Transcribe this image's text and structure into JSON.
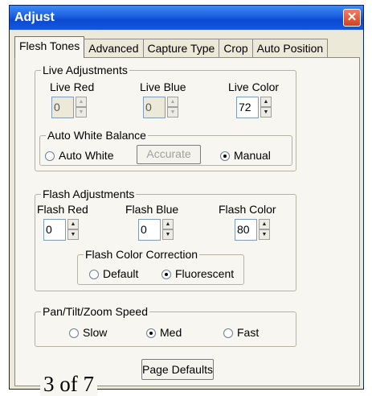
{
  "window": {
    "title": "Adjust",
    "close_glyph": "✕"
  },
  "tabs": [
    "Flesh Tones",
    "Advanced",
    "Capture Type",
    "Crop",
    "Auto Position"
  ],
  "live": {
    "legend": "Live Adjustments",
    "red": {
      "label": "Live Red",
      "value": "0"
    },
    "blue": {
      "label": "Live Blue",
      "value": "0"
    },
    "color": {
      "label": "Live Color",
      "value": "72"
    }
  },
  "awb": {
    "legend": "Auto White Balance",
    "auto_white": "Auto White",
    "accurate": "Accurate",
    "manual": "Manual",
    "selected": "manual"
  },
  "flash": {
    "legend": "Flash Adjustments",
    "red": {
      "label": "Flash Red",
      "value": "0"
    },
    "blue": {
      "label": "Flash Blue",
      "value": "0"
    },
    "color": {
      "label": "Flash Color",
      "value": "80"
    }
  },
  "fcc": {
    "legend": "Flash Color Correction",
    "default": "Default",
    "fluorescent": "Fluorescent",
    "selected": "fluorescent"
  },
  "ptz": {
    "legend": "Pan/Tilt/Zoom Speed",
    "slow": "Slow",
    "med": "Med",
    "fast": "Fast",
    "selected": "med"
  },
  "page_defaults": "Page Defaults",
  "footer": "3 of 7",
  "icons": {
    "up": "▲",
    "down": "▼"
  }
}
